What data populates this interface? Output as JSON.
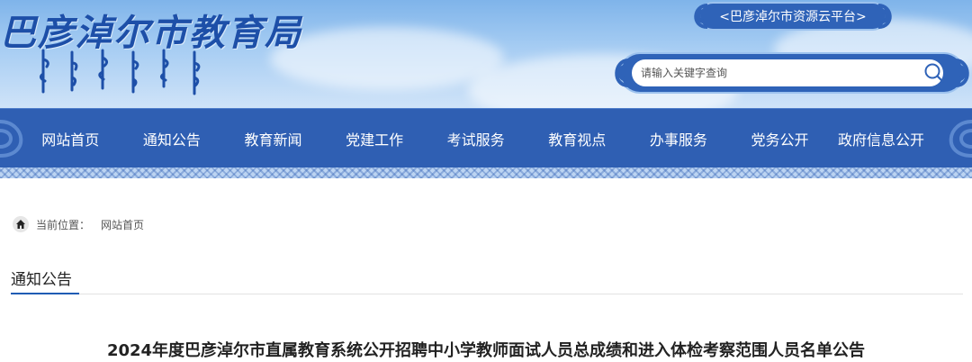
{
  "header": {
    "site_title": "巴彦淖尔市教育局",
    "platform_link": "<巴彦淖尔市资源云平台>"
  },
  "search": {
    "placeholder": "请输入关键字查询",
    "icon": "search-icon"
  },
  "nav": {
    "items": [
      "网站首页",
      "通知公告",
      "教育新闻",
      "党建工作",
      "考试服务",
      "教育视点",
      "办事服务",
      "党务公开",
      "政府信息公开"
    ]
  },
  "breadcrumb": {
    "icon": "home-icon",
    "label": "当前位置：",
    "current": "网站首页"
  },
  "section": {
    "title": "通知公告"
  },
  "article": {
    "title": "2024年度巴彦淖尔市直属教育系统公开招聘中小学教师面试人员总成绩和进入体检考察范围人员名单公告"
  },
  "colors": {
    "primary": "#2f5fb3",
    "banner_top": "#7fb4ea",
    "accent_underline": "#1f5cb4"
  }
}
